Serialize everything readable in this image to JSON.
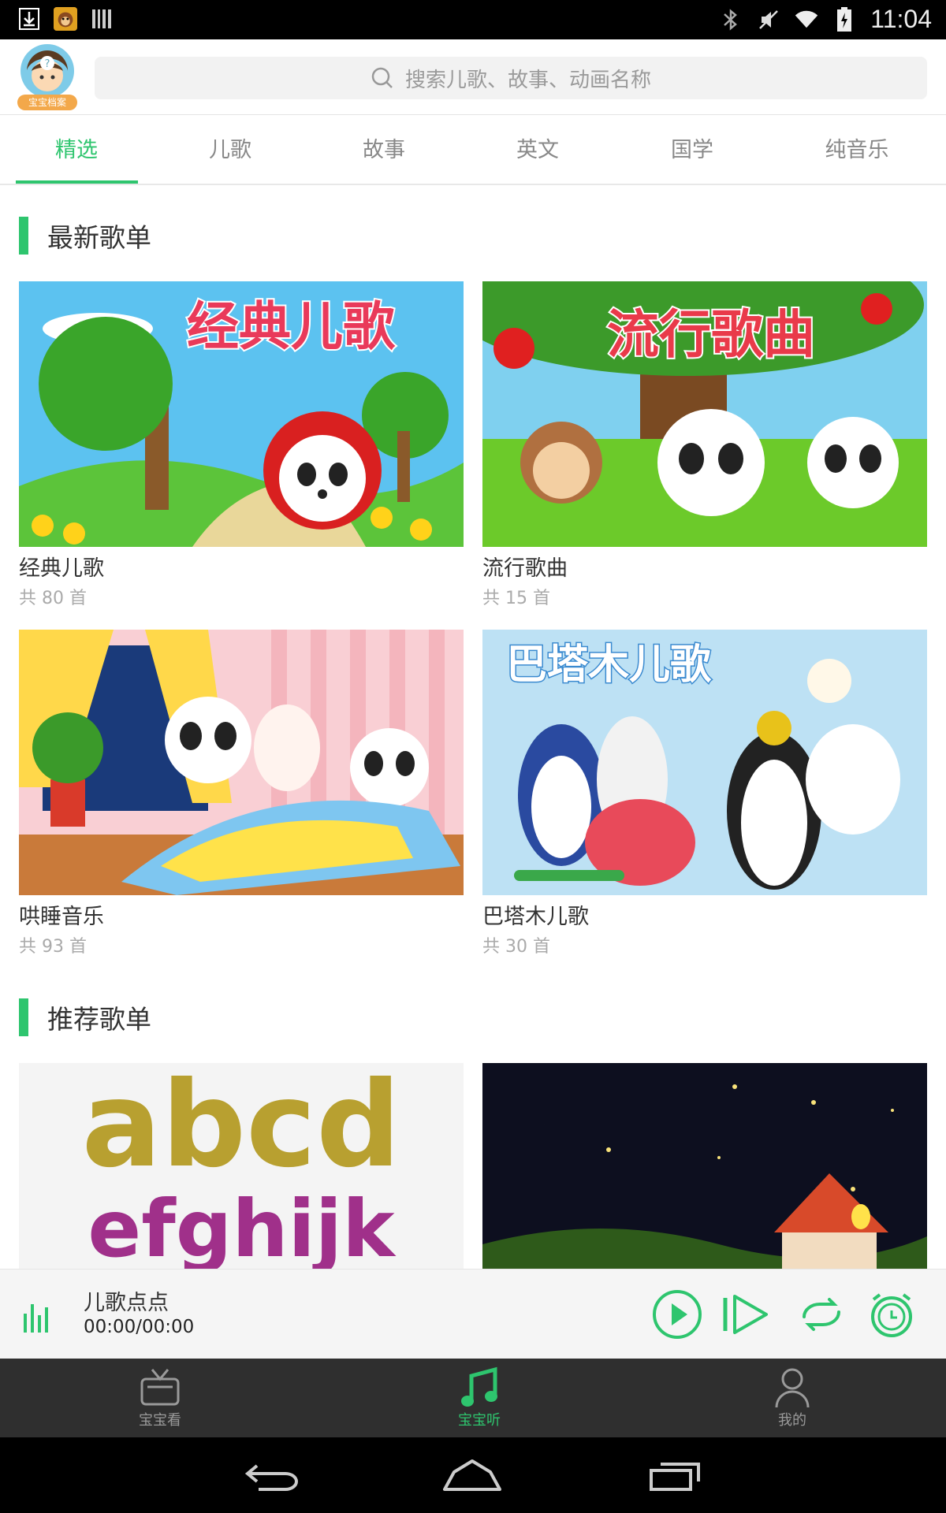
{
  "status": {
    "time": "11:04"
  },
  "search": {
    "placeholder": "搜索儿歌、故事、动画名称"
  },
  "avatar": {
    "badge": "宝宝档案"
  },
  "tabs": [
    {
      "label": "精选",
      "active": true
    },
    {
      "label": "儿歌"
    },
    {
      "label": "故事"
    },
    {
      "label": "英文"
    },
    {
      "label": "国学"
    },
    {
      "label": "纯音乐"
    }
  ],
  "sections": {
    "latest": {
      "title": "最新歌单",
      "cards": [
        {
          "title": "经典儿歌",
          "count": "共 80 首",
          "banner": "经典儿歌"
        },
        {
          "title": "流行歌曲",
          "count": "共 15 首",
          "banner": "流行歌曲"
        },
        {
          "title": "哄睡音乐",
          "count": "共 93 首"
        },
        {
          "title": "巴塔木儿歌",
          "count": "共 30 首",
          "banner": "巴塔木儿歌"
        }
      ]
    },
    "recommended": {
      "title": "推荐歌单",
      "cards": [
        {
          "banner_line1": "abcd",
          "banner_line2": "efghijk"
        },
        {}
      ]
    }
  },
  "player": {
    "title": "儿歌点点",
    "time": "00:00/00:00"
  },
  "bottom_nav": [
    {
      "label": "宝宝看"
    },
    {
      "label": "宝宝听",
      "active": true
    },
    {
      "label": "我的"
    }
  ],
  "colors": {
    "accent": "#2ec56e",
    "nav_bg": "#2f2f2f"
  }
}
